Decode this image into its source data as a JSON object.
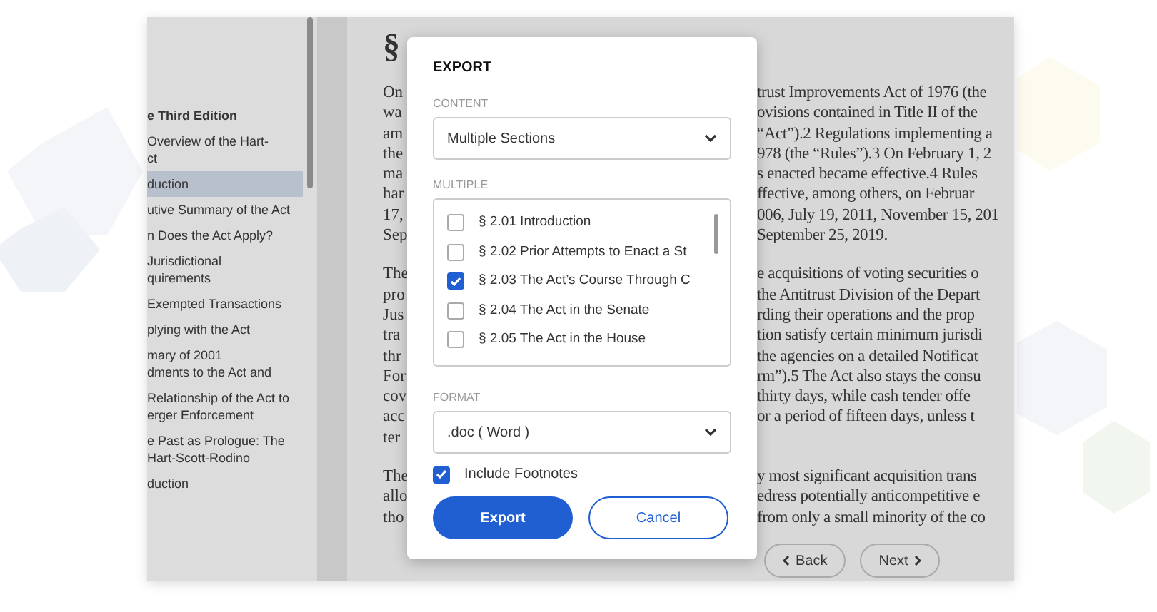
{
  "sidebar": {
    "items": [
      {
        "lines": [
          "e Third Edition"
        ],
        "kind": "heading",
        "selected": false
      },
      {
        "lines": [
          "Overview of the Hart-",
          "ct"
        ],
        "kind": "link",
        "selected": false
      },
      {
        "lines": [
          "duction"
        ],
        "kind": "link",
        "selected": true
      },
      {
        "lines": [
          "utive Summary of the Act"
        ],
        "kind": "link",
        "selected": false
      },
      {
        "lines": [
          "n Does the Act Apply?"
        ],
        "kind": "link",
        "selected": false
      },
      {
        "lines": [
          "Jurisdictional",
          "quirements"
        ],
        "kind": "link",
        "selected": false
      },
      {
        "lines": [
          "Exempted Transactions"
        ],
        "kind": "link",
        "selected": false
      },
      {
        "lines": [
          "plying with the Act"
        ],
        "kind": "link",
        "selected": false
      },
      {
        "lines": [
          "mary of 2001",
          "dments to the Act and"
        ],
        "kind": "link",
        "selected": false
      },
      {
        "lines": [
          "Relationship of the Act to",
          "erger Enforcement"
        ],
        "kind": "link",
        "selected": false
      },
      {
        "lines": [
          "e Past as Prologue: The",
          "Hart-Scott-Rodino"
        ],
        "kind": "link",
        "selected": false
      },
      {
        "lines": [
          "duction"
        ],
        "kind": "link",
        "selected": false
      }
    ]
  },
  "document": {
    "title": "§",
    "paragraphs": [
      [
        [
          "On",
          "trust Improvements Act of 1976 (the"
        ],
        [
          "wa",
          "ovisions contained in Title II of the"
        ],
        [
          "am",
          "“Act”).2 Regulations implementing a"
        ],
        [
          "the",
          "978 (the “Rules”).3 On February 1, 2"
        ],
        [
          "ma",
          "s enacted became effective.4 Rules"
        ],
        [
          "har",
          "ffective, among others, on Februar"
        ],
        [
          "17,",
          "006, July 19, 2011, November 15, 201"
        ],
        [
          "Sep",
          "September 25, 2019."
        ]
      ],
      [
        [
          "The",
          "e acquisitions of voting securities o"
        ],
        [
          "pro",
          "the Antitrust Division of the Depart"
        ],
        [
          "Jus",
          "rding their operations and the prop"
        ],
        [
          "tra",
          "tion satisfy certain minimum jurisdi"
        ],
        [
          "thr",
          "the agencies on a detailed Notificat"
        ],
        [
          "For",
          "rm”).5 The Act also stays the consu"
        ],
        [
          "cov",
          "thirty days, while cash tender offe"
        ],
        [
          "acc",
          "or a period of fifteen days, unless t"
        ],
        [
          "ter"
        ]
      ],
      [
        [
          "The",
          "y most significant acquisition trans"
        ],
        [
          "allo",
          "edress potentially anticompetitive e"
        ],
        [
          "tho",
          "from only a small minority of the co"
        ]
      ]
    ],
    "nav": [
      "Back",
      "Next"
    ]
  },
  "dialog": {
    "title": "EXPORT",
    "content_label": "CONTENT",
    "content_value": "Multiple Sections",
    "multiple_label": "MULTIPLE",
    "sections": [
      {
        "label": "§ 2.01 Introduction",
        "checked": false
      },
      {
        "label": "§ 2.02 Prior Attempts to Enact a St",
        "checked": false
      },
      {
        "label": "§ 2.03 The Act’s Course Through C",
        "checked": true
      },
      {
        "label": "§ 2.04 The Act in the Senate",
        "checked": false
      },
      {
        "label": "§ 2.05 The Act in the House",
        "checked": false
      }
    ],
    "format_label": "FORMAT",
    "format_value": ".doc ( Word )",
    "include_footnotes": {
      "label": "Include Footnotes",
      "checked": true
    },
    "buttons": [
      {
        "label": "Export",
        "kind": "primary"
      },
      {
        "label": "Cancel",
        "kind": "secondary"
      }
    ]
  }
}
